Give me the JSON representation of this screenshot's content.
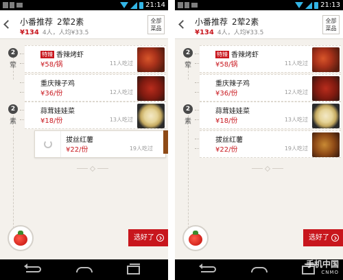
{
  "screens": [
    {
      "status": {
        "time": "21:14"
      },
      "header": {
        "title": "小番推荐",
        "dish_count": "2荤2素",
        "price": "¥134",
        "meta": "4人，人均¥33.5",
        "all_dishes_line1": "全部",
        "all_dishes_line2": "菜品"
      },
      "categories": [
        {
          "count": "2",
          "label": "荤"
        },
        {
          "count": "2",
          "label": "素"
        }
      ],
      "dishes": [
        {
          "tag": "特辣",
          "name": "香辣烤虾",
          "price": "¥58/锅",
          "eaten": "11人吃过",
          "image": "grilled-shrimp"
        },
        {
          "name": "重庆辣子鸡",
          "price": "¥36/份",
          "eaten": "12人吃过",
          "image": "spicy-chicken"
        },
        {
          "name": "蒜茸娃娃菜",
          "price": "¥18/份",
          "eaten": "13人吃过",
          "image": "baby-cabbage"
        },
        {
          "name": "拔丝红薯",
          "price": "¥22/份",
          "eaten": "19人吃过",
          "image": "candied-sweet-potato"
        }
      ],
      "done_button": "选好了"
    },
    {
      "status": {
        "time": "21:13"
      },
      "header": {
        "title": "小番推荐",
        "dish_count": "2荤2素",
        "price": "¥134",
        "meta": "4人，人均¥33.5",
        "all_dishes_line1": "全部",
        "all_dishes_line2": "菜品"
      },
      "categories": [
        {
          "count": "2",
          "label": "荤"
        },
        {
          "count": "2",
          "label": "素"
        }
      ],
      "dishes": [
        {
          "tag": "特辣",
          "name": "香辣烤虾",
          "price": "¥58/锅",
          "eaten": "11人吃过",
          "image": "grilled-shrimp"
        },
        {
          "name": "重庆辣子鸡",
          "price": "¥36/份",
          "eaten": "12人吃过",
          "image": "spicy-chicken"
        },
        {
          "name": "蒜茸娃娃菜",
          "price": "¥18/份",
          "eaten": "13人吃过",
          "image": "baby-cabbage"
        },
        {
          "name": "拔丝红薯",
          "price": "¥22/份",
          "eaten": "19人吃过",
          "image": "candied-sweet-potato"
        }
      ],
      "done_button": "选好了"
    }
  ],
  "watermark": {
    "main": "手机中国",
    "sub": "CNMO"
  },
  "colors": {
    "accent": "#c8161d",
    "status_icon": "#33b5e5",
    "background": "#f4f1ec"
  }
}
